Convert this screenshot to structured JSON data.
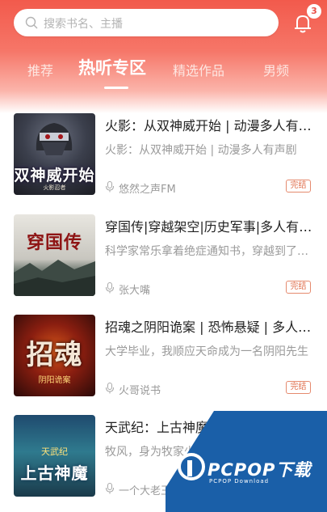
{
  "search": {
    "placeholder": "搜索书名、主播"
  },
  "notifications": {
    "count": "3"
  },
  "tabs": [
    {
      "label": "推荐"
    },
    {
      "label": "热听专区"
    },
    {
      "label": "精选作品"
    },
    {
      "label": "男频"
    }
  ],
  "active_tab": "热听专区",
  "items": [
    {
      "title": "火影：从双神威开始 | 动漫多人有声剧",
      "desc": "火影：从双神威开始 | 动漫多人有声剧",
      "host": "悠然之声FM",
      "status": "完结",
      "cover_text": "双神威开始",
      "cover_sub": "火影忍者"
    },
    {
      "title": "穿国传|穿越架空|历史军事|多人有声剧",
      "desc": "科学家常乐拿着绝症通知书，穿越到了古代",
      "host": "张大嘴",
      "status": "完结",
      "cover_text": "穿国传",
      "cover_sub": ""
    },
    {
      "title": "招魂之阴阳诡案 | 恐怖悬疑 | 多人有声剧",
      "desc": "大学毕业，我顺应天命成为一名阴阳先生",
      "host": "火哥说书",
      "status": "完结",
      "cover_text": "招魂",
      "cover_sub": "阴阳诡案"
    },
    {
      "title": "天武纪：上古神魔",
      "desc": "牧风，身为牧家少家主，",
      "host": "一个大老王",
      "status": "",
      "cover_text": "上古神魔",
      "cover_sub": "天武纪"
    }
  ],
  "watermark": {
    "brand": "PCPOP下载",
    "sub": "PCPOP Download"
  },
  "colors": {
    "accent": "#f25a4c",
    "status": "#e0704f",
    "watermark": "#1a5fa8"
  }
}
